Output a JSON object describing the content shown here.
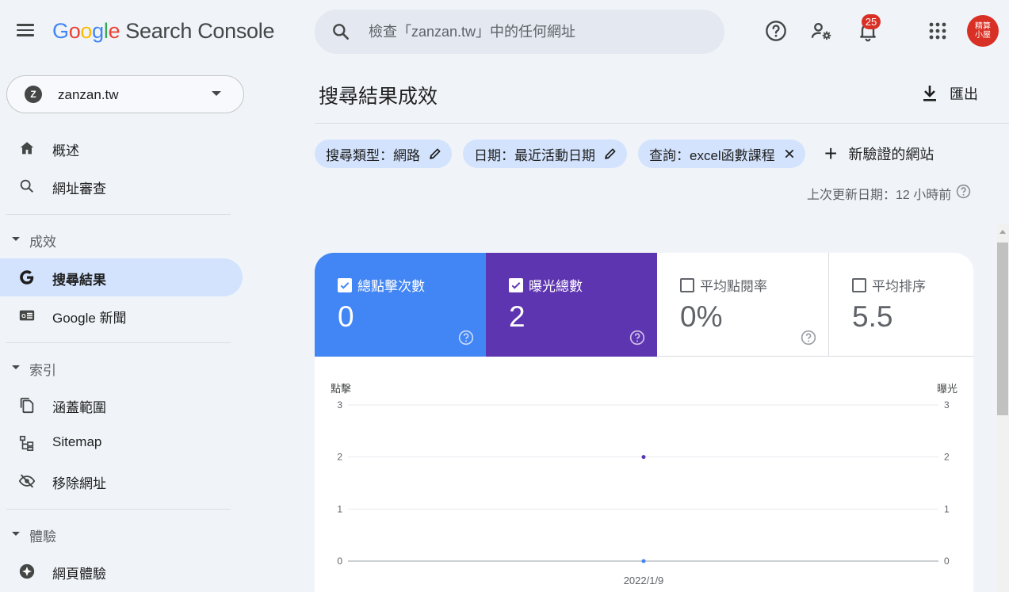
{
  "app": {
    "logo_letters": [
      "G",
      "o",
      "o",
      "g",
      "l",
      "e"
    ],
    "product_name": "Search Console"
  },
  "search": {
    "placeholder": "檢查「zanzan.tw」中的任何網址"
  },
  "header": {
    "notification_count": "25",
    "avatar_text_line1": "精算",
    "avatar_text_line2": "小屋"
  },
  "property": {
    "name": "zanzan.tw",
    "icon_text": "Z"
  },
  "sidebar": {
    "items": [
      {
        "label": "概述",
        "icon": "home-icon"
      },
      {
        "label": "網址審查",
        "icon": "search-icon"
      }
    ],
    "sections": [
      {
        "title": "成效",
        "items": [
          {
            "label": "搜尋結果",
            "icon": "google-g-icon",
            "active": true
          },
          {
            "label": "Google 新聞",
            "icon": "news-icon"
          }
        ]
      },
      {
        "title": "索引",
        "items": [
          {
            "label": "涵蓋範圍",
            "icon": "copy-pages-icon"
          },
          {
            "label": "Sitemap",
            "icon": "sitemap-icon"
          },
          {
            "label": "移除網址",
            "icon": "eye-off-icon"
          }
        ]
      },
      {
        "title": "體驗",
        "items": [
          {
            "label": "網頁體驗",
            "icon": "page-experience-icon"
          }
        ]
      }
    ]
  },
  "main": {
    "title": "搜尋結果成效",
    "export_label": "匯出",
    "filters": [
      {
        "label": "搜尋類型：網路",
        "action": "edit"
      },
      {
        "label": "日期：最近活動日期",
        "action": "edit"
      },
      {
        "label": "查詢：excel函數課程",
        "action": "remove"
      }
    ],
    "add_filter_label": "新驗證的網站",
    "last_updated": "上次更新日期：12 小時前"
  },
  "metrics": [
    {
      "label": "總點擊次數",
      "value": "0",
      "checked": true,
      "color": "#4285f4"
    },
    {
      "label": "曝光總數",
      "value": "2",
      "checked": true,
      "color": "#5e35b1"
    },
    {
      "label": "平均點閱率",
      "value": "0%",
      "checked": false
    },
    {
      "label": "平均排序",
      "value": "5.5",
      "checked": false
    }
  ],
  "chart_data": {
    "type": "line",
    "x": [
      "2022/1/9"
    ],
    "series": [
      {
        "name": "點擊",
        "values": [
          0
        ],
        "color": "#4285f4",
        "axis": "left"
      },
      {
        "name": "曝光",
        "values": [
          2
        ],
        "color": "#5e35b1",
        "axis": "right"
      }
    ],
    "ylabel_left": "點擊",
    "ylabel_right": "曝光",
    "yticks_left": [
      "0",
      "1",
      "2",
      "3"
    ],
    "yticks_right": [
      "0",
      "1",
      "2",
      "3"
    ],
    "ylim": [
      0,
      3
    ],
    "grid": true
  }
}
